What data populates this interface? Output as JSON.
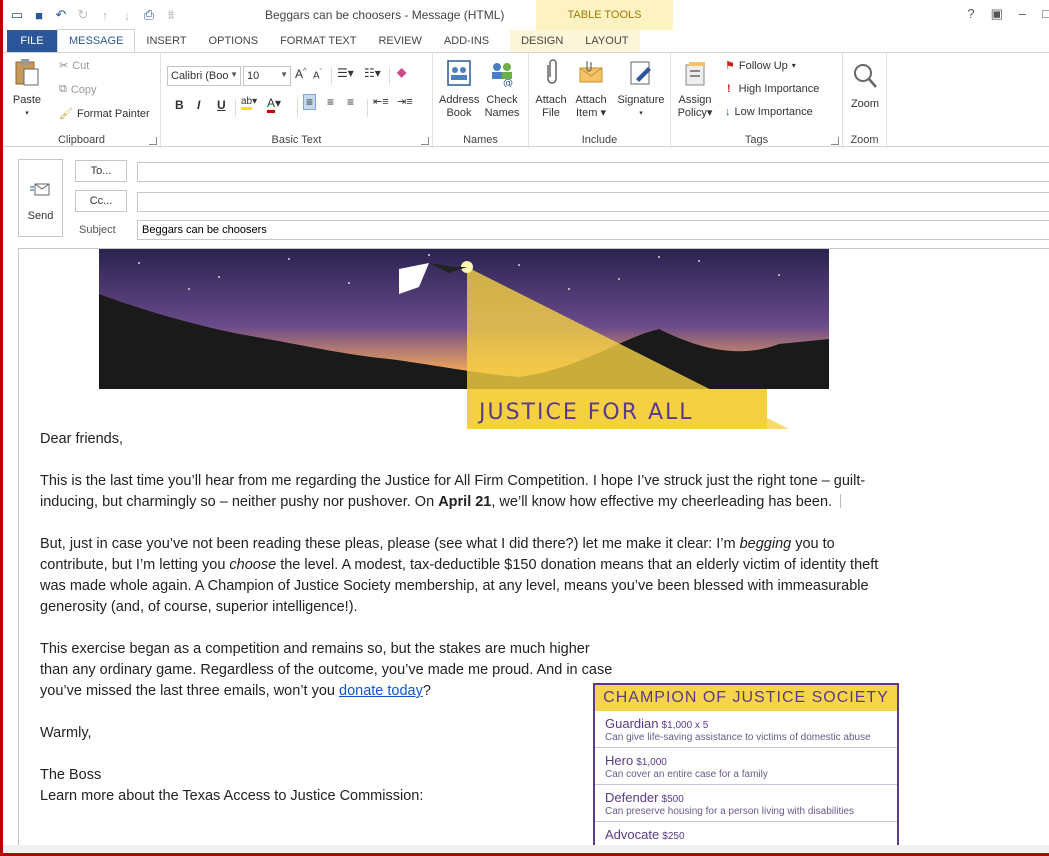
{
  "window": {
    "title": "Beggars can be choosers - Message (HTML)",
    "context_tab_header": "TABLE TOOLS",
    "controls": [
      "?",
      "▣",
      "–",
      "□"
    ]
  },
  "tabs": [
    {
      "label": "FILE"
    },
    {
      "label": "MESSAGE"
    },
    {
      "label": "INSERT"
    },
    {
      "label": "OPTIONS"
    },
    {
      "label": "FORMAT TEXT"
    },
    {
      "label": "REVIEW"
    },
    {
      "label": "ADD-INS"
    },
    {
      "label": "DESIGN"
    },
    {
      "label": "LAYOUT"
    }
  ],
  "ribbon": {
    "clipboard": {
      "label": "Clipboard",
      "paste": "Paste",
      "cut": "Cut",
      "copy": "Copy",
      "format_painter": "Format Painter"
    },
    "basic_text": {
      "label": "Basic Text",
      "font": "Calibri (Boo",
      "size": "10",
      "bold": "B",
      "italic": "I",
      "underline": "U",
      "highlight_colors": {
        "highlight": "#f5e400",
        "font": "#d00000"
      }
    },
    "names": {
      "label": "Names",
      "address_book_1": "Address",
      "address_book_2": "Book",
      "check_names_1": "Check",
      "check_names_2": "Names"
    },
    "include": {
      "label": "Include",
      "attach_file_1": "Attach",
      "attach_file_2": "File",
      "attach_item_1": "Attach",
      "attach_item_2": "Item",
      "signature": "Signature"
    },
    "tags": {
      "label": "Tags",
      "assign_policy_1": "Assign",
      "assign_policy_2": "Policy",
      "follow_up": "Follow Up",
      "high_importance": "High Importance",
      "low_importance": "Low Importance"
    },
    "zoom": {
      "label": "Zoom",
      "zoom": "Zoom"
    }
  },
  "header": {
    "send": "Send",
    "to_button": "To...",
    "cc_button": "Cc...",
    "subject_label": "Subject",
    "to_value": "",
    "cc_value": "",
    "subject_value": "Beggars can be choosers"
  },
  "banner": {
    "text": "JUSTICE FOR ALL"
  },
  "message": {
    "greeting": "Dear friends,",
    "p1_a": "This is the last time you’ll hear from me regarding the Justice for All Firm Competition. I hope I’ve struck just the right tone – guilt-inducing, but charmingly so – neither pushy nor pushover. On ",
    "p1_bold": "April 21",
    "p1_b": ", we’ll know how effective my cheerleading has been.",
    "p2_a": "But, just in case you’ve not been reading these pleas, please (see what I did there?) let me make it clear: I’m ",
    "p2_em1": "begging",
    "p2_b": " you to contribute, but I’m letting you ",
    "p2_em2": "choose",
    "p2_c": " the level. A modest, tax-deductible $150 donation means that an elderly victim of identity theft was made whole again. A Champion of Justice Society membership, at any level, means you’ve been blessed with immeasurable generosity (and, of course, superior intelligence!).",
    "p3_a": "This exercise began as a competition and remains so, but the stakes are much higher than any ordinary game. Regardless of the outcome, you’ve made me proud. And in case you’ve missed the last three emails, won’t you ",
    "p3_link": "donate today",
    "p3_b": "?",
    "closing": "Warmly,",
    "signature": "The Boss",
    "learn_more": "Learn more about the Texas Access to Justice Commission:"
  },
  "society": {
    "title": "CHAMPION OF JUSTICE SOCIETY",
    "tiers": [
      {
        "name": "Guardian",
        "amount": "$1,000 x 5",
        "desc": "Can give life-saving assistance to victims of domestic abuse"
      },
      {
        "name": "Hero",
        "amount": "$1,000",
        "desc": "Can cover an entire case for a family"
      },
      {
        "name": "Defender",
        "amount": "$500",
        "desc": "Can preserve housing for a person living with disabilities"
      },
      {
        "name": "Advocate",
        "amount": "$250",
        "desc": ""
      }
    ]
  }
}
